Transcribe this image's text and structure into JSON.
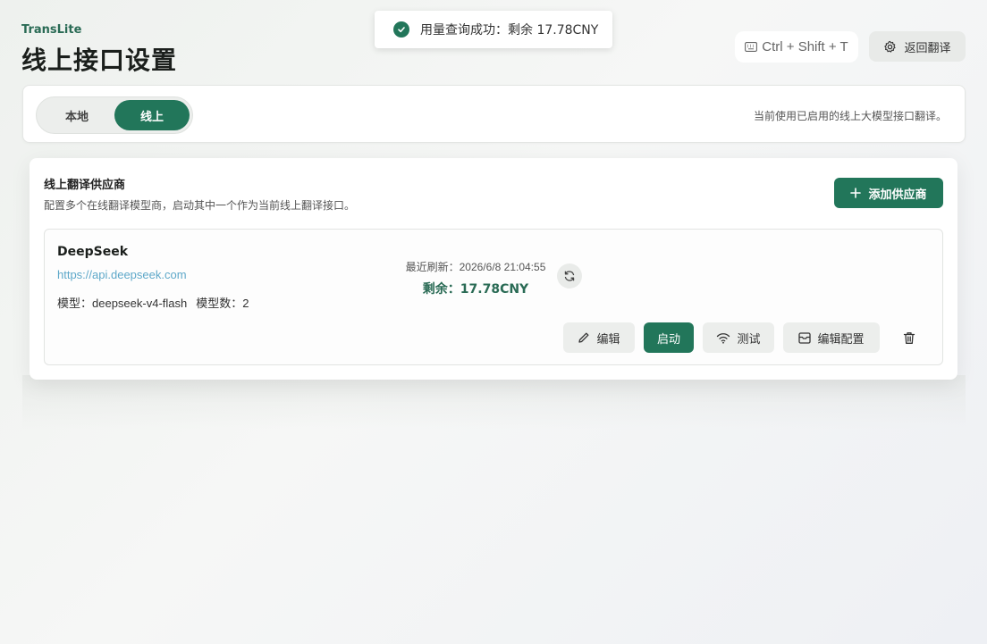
{
  "header": {
    "app_name": "TransLite",
    "page_title": "线上接口设置",
    "shortcut": "Ctrl + Shift + T",
    "back_label": "返回翻译"
  },
  "toast": {
    "message": "用量查询成功：剩余 17.78CNY"
  },
  "mode": {
    "options": [
      "本地",
      "线上"
    ],
    "selected": "线上",
    "description": "当前使用已启用的线上大模型接口翻译。"
  },
  "providers_panel": {
    "title": "线上翻译供应商",
    "subtitle": "配置多个在线翻译模型商，启动其中一个作为当前线上翻译接口。",
    "add_label": "添加供应商",
    "providers": [
      {
        "name": "DeepSeek",
        "url": "https://api.deepseek.com",
        "model": "模型：deepseek-v4-flash",
        "model_count": "模型数：2",
        "refreshed": "最近刷新：2026/6/8 21:04:55",
        "balance": "剩余：17.78CNY",
        "actions": {
          "edit": "编辑",
          "start": "启动",
          "test": "测试",
          "edit_config": "编辑配置"
        }
      }
    ]
  },
  "colors": {
    "accent": "#22765a",
    "accent_text": "#2a6b55",
    "link": "#5ea8c9"
  },
  "icons": [
    "check-circle-icon",
    "keyboard-icon",
    "gear-icon",
    "plus-icon",
    "refresh-icon",
    "pencil-icon",
    "wifi-icon",
    "archive-icon",
    "trash-icon"
  ]
}
